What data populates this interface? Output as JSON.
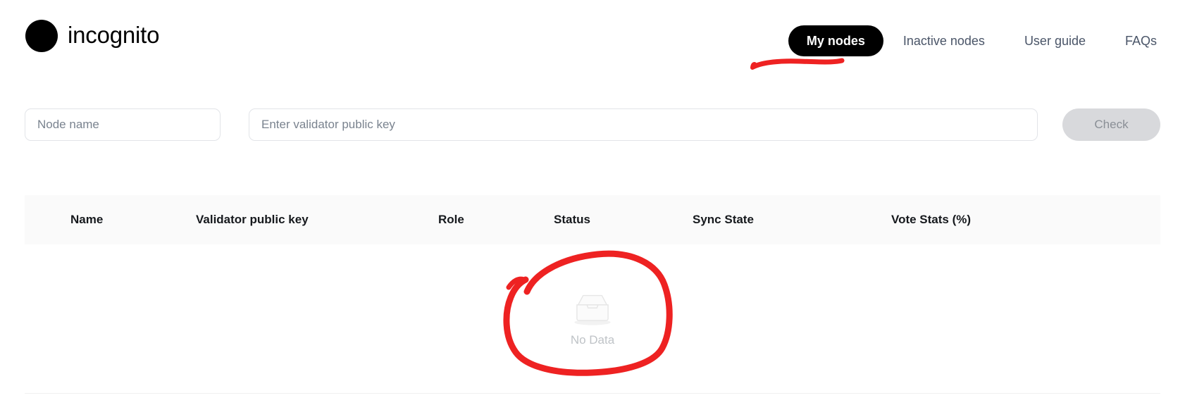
{
  "brand": {
    "logo_icon": "black-circle-logo",
    "name": "incognito"
  },
  "nav": {
    "items": [
      {
        "label": "My nodes",
        "active": true
      },
      {
        "label": "Inactive nodes",
        "active": false
      },
      {
        "label": "User guide",
        "active": false
      },
      {
        "label": "FAQs",
        "active": false
      }
    ]
  },
  "filters": {
    "node_name": {
      "value": "",
      "placeholder": "Node name"
    },
    "validator_key": {
      "value": "",
      "placeholder": "Enter validator public key"
    },
    "check_button": {
      "label": "Check",
      "disabled": true
    }
  },
  "table": {
    "columns": [
      "Name",
      "Validator public key",
      "Role",
      "Status",
      "Sync State",
      "Vote Stats (%)"
    ],
    "rows": [],
    "empty_state": {
      "icon": "inbox-tray-icon",
      "text": "No Data"
    }
  },
  "annotations": {
    "color": "#ee2222",
    "items": [
      {
        "name": "underline-my-nodes",
        "shape": "hand-drawn-underline"
      },
      {
        "name": "circle-no-data",
        "shape": "hand-drawn-ellipse"
      }
    ]
  },
  "colors": {
    "accent": "#000000",
    "nav_text": "#4a5568",
    "table_header_bg": "#fafafa",
    "muted_text": "#bfc3c7",
    "annotation_red": "#ee2222"
  }
}
